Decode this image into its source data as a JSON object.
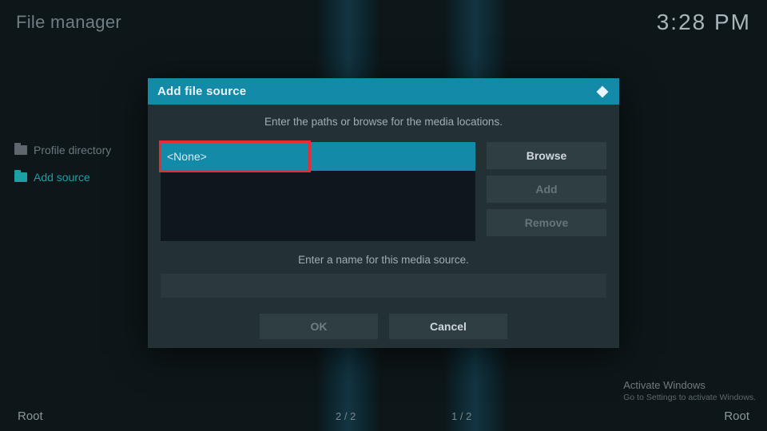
{
  "header": {
    "title": "File manager",
    "clock": "3:28 PM"
  },
  "sidebar": {
    "items": [
      {
        "label": "Profile directory",
        "accent": false
      },
      {
        "label": "Add source",
        "accent": true
      }
    ]
  },
  "dialog": {
    "title": "Add file source",
    "instruction": "Enter the paths or browse for the media locations.",
    "path_value": "<None>",
    "browse_label": "Browse",
    "add_label": "Add",
    "remove_label": "Remove",
    "name_instruction": "Enter a name for this media source.",
    "name_value": "",
    "ok_label": "OK",
    "cancel_label": "Cancel"
  },
  "footer": {
    "left_label": "Root",
    "left_counter": "2 / 2",
    "right_counter": "1 / 2",
    "right_label": "Root"
  },
  "watermark": {
    "line1": "Activate Windows",
    "line2": "Go to Settings to activate Windows."
  }
}
